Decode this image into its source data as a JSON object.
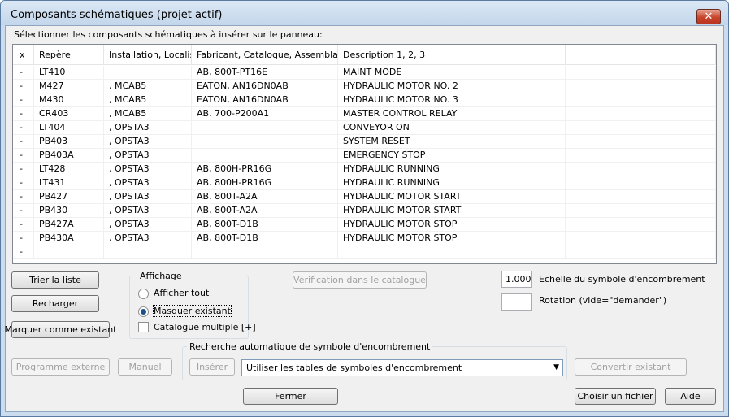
{
  "window": {
    "title": "Composants schématiques (projet actif)",
    "close_glyph": "✕"
  },
  "instruction": "Sélectionner les composants schématiques à insérer sur le panneau:",
  "table": {
    "columns": [
      "x",
      "Repère",
      "Installation, Localis...",
      "Fabricant, Catalogue, Assemblage",
      "Description 1, 2, 3",
      ""
    ],
    "rows": [
      [
        "-",
        "LT410",
        "",
        "AB, 800T-PT16E",
        "MAINT MODE"
      ],
      [
        "-",
        "M427",
        ", MCAB5",
        "EATON, AN16DN0AB",
        "HYDRAULIC MOTOR NO. 2"
      ],
      [
        "-",
        "M430",
        ", MCAB5",
        "EATON, AN16DN0AB",
        "HYDRAULIC MOTOR NO. 3"
      ],
      [
        "-",
        "CR403",
        ", MCAB5",
        "AB, 700-P200A1",
        "MASTER CONTROL RELAY"
      ],
      [
        "-",
        "LT404",
        ", OPSTA3",
        "",
        "CONVEYOR ON"
      ],
      [
        "-",
        "PB403",
        ", OPSTA3",
        "",
        "SYSTEM RESET"
      ],
      [
        "-",
        "PB403A",
        ", OPSTA3",
        "",
        "EMERGENCY STOP"
      ],
      [
        "-",
        "LT428",
        ", OPSTA3",
        "AB, 800H-PR16G",
        "HYDRAULIC RUNNING"
      ],
      [
        "-",
        "LT431",
        ", OPSTA3",
        "AB, 800H-PR16G",
        "HYDRAULIC RUNNING"
      ],
      [
        "-",
        "PB427",
        ", OPSTA3",
        "AB, 800T-A2A",
        "HYDRAULIC MOTOR START"
      ],
      [
        "-",
        "PB430",
        ", OPSTA3",
        "AB, 800T-A2A",
        "HYDRAULIC MOTOR START"
      ],
      [
        "-",
        "PB427A",
        ", OPSTA3",
        "AB, 800T-D1B",
        "HYDRAULIC MOTOR STOP"
      ],
      [
        "-",
        "PB430A",
        ", OPSTA3",
        "AB, 800T-D1B",
        "HYDRAULIC MOTOR STOP"
      ],
      [
        "-",
        "",
        "",
        "",
        ""
      ]
    ]
  },
  "buttons": {
    "trier": "Trier la liste",
    "recharger": "Recharger",
    "marquer": "Marquer comme existant",
    "verification": "Vérification dans le catalogue",
    "programme": "Programme externe",
    "manuel": "Manuel",
    "inserer": "Insérer",
    "convertir": "Convertir existant",
    "fermer": "Fermer",
    "choisir": "Choisir un fichier",
    "aide": "Aide"
  },
  "affichage": {
    "legend": "Affichage",
    "afficher_tout": "Afficher tout",
    "masquer_existant": "Masquer existant",
    "catalogue_multiple": "Catalogue multiple [+]"
  },
  "scale": {
    "value": "1.000",
    "label": "Echelle du symbole d'encombrement"
  },
  "rotation": {
    "value": "",
    "label": "Rotation (vide=\"demander\")"
  },
  "recherche": {
    "legend": "Recherche automatique de symbole d'encombrement",
    "combo_value": "Utiliser les tables de symboles d'encombrement"
  }
}
